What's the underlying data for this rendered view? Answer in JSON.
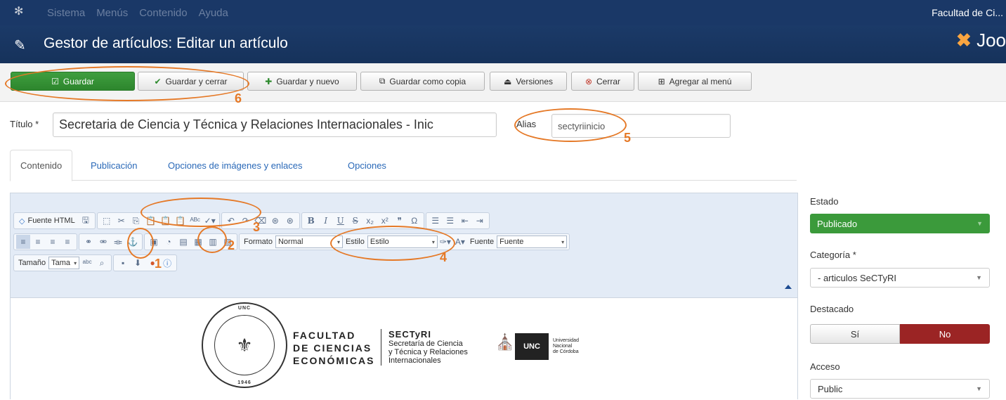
{
  "topbar": {
    "logo_icon": "joomla-icon",
    "menu": [
      "Sistema",
      "Menús",
      "Contenido",
      "Ayuda"
    ],
    "site_name": "Facultad de Ci..."
  },
  "header": {
    "title": "Gestor de artículos: Editar un artículo",
    "brand": "Joo"
  },
  "toolbar": {
    "save": "Guardar",
    "save_close": "Guardar y cerrar",
    "save_new": "Guardar y nuevo",
    "save_copy": "Guardar como copia",
    "versions": "Versiones",
    "close": "Cerrar",
    "add_menu": "Agregar al menú"
  },
  "form": {
    "title_label": "Título *",
    "title_value": "Secretaria de Ciencia y Técnica y Relaciones Internacionales - Inic",
    "alias_label": "Alias",
    "alias_value": "sectyriinicio"
  },
  "tabs": [
    "Contenido",
    "Publicación",
    "Opciones de imágenes y enlaces",
    "Opciones"
  ],
  "editor": {
    "source_html": "Fuente HTML",
    "format_label": "Formato",
    "format_value": "Normal",
    "style_label": "Estilo",
    "style_value": "Estilo",
    "font_label": "Fuente",
    "font_value": "Fuente",
    "size_label": "Tamaño",
    "size_value": "Tama"
  },
  "content": {
    "faculty_lines": [
      "FACULTAD",
      "DE CIENCIAS",
      "ECONÓMICAS"
    ],
    "sectyri_title": "SECTyRI",
    "sectyri_lines": [
      "Secretaría de Ciencia",
      "y Técnica y Relaciones",
      "Internacionales"
    ],
    "unc_box": "UNC",
    "unc_lines": [
      "Universidad",
      "Nacional",
      "de Córdoba"
    ],
    "seal_top": "UNC",
    "seal_year": "1946"
  },
  "sidebar": {
    "estado_label": "Estado",
    "estado_value": "Publicado",
    "categoria_label": "Categoría *",
    "categoria_value": "- articulos SeCTyRI",
    "destacado_label": "Destacado",
    "destacado_yes": "Sí",
    "destacado_no": "No",
    "acceso_label": "Acceso",
    "acceso_value": "Public"
  },
  "annotations": [
    "1",
    "2",
    "3",
    "4",
    "5",
    "6"
  ],
  "colors": {
    "topbar": "#1a3867",
    "green": "#2d862d",
    "red": "#9b2424",
    "annotation": "#e57927",
    "link": "#2a69b8"
  }
}
